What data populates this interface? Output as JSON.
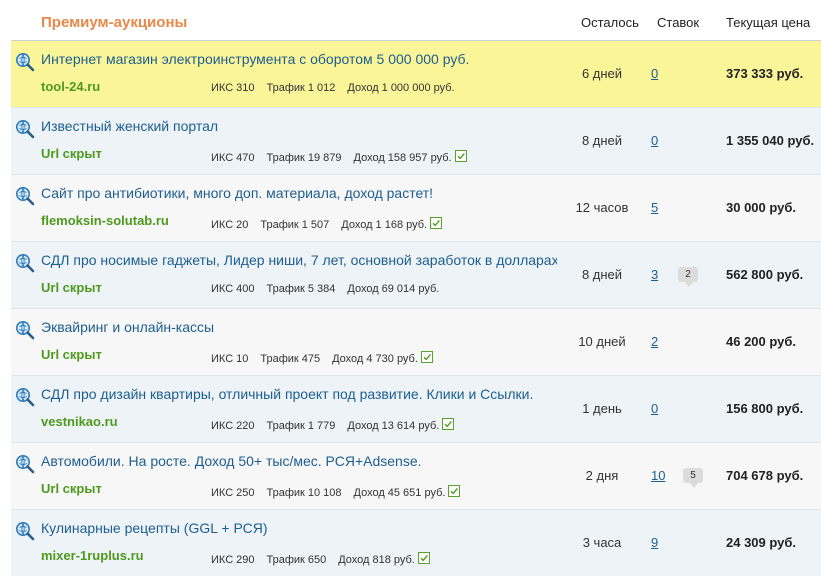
{
  "header": {
    "title": "Премиум-аукционы",
    "col_left": "Осталось",
    "col_bids": "Ставок",
    "col_price": "Текущая цена"
  },
  "stat_labels": {
    "iks": "ИКС",
    "traffic": "Трафик",
    "income": "Доход"
  },
  "rows": [
    {
      "title": "Интернет магазин электроинструмента с оборотом 5 000 000 руб.",
      "site": "tool-24.ru",
      "iks": "310",
      "traffic": "1 012",
      "income": "1 000 000 руб.",
      "verified": false,
      "left": "6 дней",
      "bids": "0",
      "comments": "",
      "price": "373 333 руб."
    },
    {
      "title": "Известный женский портал",
      "site": "Url скрыт",
      "iks": "470",
      "traffic": "19 879",
      "income": "158 957 руб.",
      "verified": true,
      "left": "8 дней",
      "bids": "0",
      "comments": "",
      "price": "1 355 040 руб."
    },
    {
      "title": "Сайт про антибиотики, много доп. материала, доход растет!",
      "site": "flemoksin-solutab.ru",
      "iks": "20",
      "traffic": "1 507",
      "income": "1 168 руб.",
      "verified": true,
      "left": "12 часов",
      "bids": "5",
      "comments": "",
      "price": "30 000 руб."
    },
    {
      "title": "СДЛ про носимые гаджеты, Лидер ниши, 7 лет, основной заработок в долларах",
      "site": "Url скрыт",
      "iks": "400",
      "traffic": "5 384",
      "income": "69 014 руб.",
      "verified": false,
      "left": "8 дней",
      "bids": "3",
      "comments": "2",
      "price": "562 800 руб."
    },
    {
      "title": "Эквайринг и онлайн-кассы",
      "site": "Url скрыт",
      "iks": "10",
      "traffic": "475",
      "income": "4 730 руб.",
      "verified": true,
      "left": "10 дней",
      "bids": "2",
      "comments": "",
      "price": "46 200 руб."
    },
    {
      "title": "СДЛ про дизайн квартиры, отличный проект под развитие. Клики и Ссылки.",
      "site": "vestnikao.ru",
      "iks": "220",
      "traffic": "1 779",
      "income": "13 614 руб.",
      "verified": true,
      "left": "1 день",
      "bids": "0",
      "comments": "",
      "price": "156 800 руб."
    },
    {
      "title": "Автомобили. На росте. Доход 50+ тыс/мес. РСЯ+Adsense.",
      "site": "Url скрыт",
      "iks": "250",
      "traffic": "10 108",
      "income": "45 651 руб.",
      "verified": true,
      "left": "2 дня",
      "bids": "10",
      "comments": "5",
      "price": "704 678 руб."
    },
    {
      "title": "Кулинарные рецепты (GGL + РСЯ)",
      "site": "mixer-1ruplus.ru",
      "iks": "290",
      "traffic": "650",
      "income": "818 руб.",
      "verified": true,
      "left": "3 часа",
      "bids": "9",
      "comments": "",
      "price": "24 309 руб."
    }
  ],
  "colors": {
    "title_orange": "#e8894a",
    "link_blue": "#1c5e8f",
    "site_green": "#4e9a1e",
    "highlight_yellow": "#fbf59a",
    "row_blue": "#edf3f7",
    "row_gray": "#f7f7f7"
  },
  "icons": {
    "row_icon": "magnifier-globe-icon",
    "verified_icon": "checkbox-check-icon",
    "comment_icon": "speech-bubble-icon"
  }
}
